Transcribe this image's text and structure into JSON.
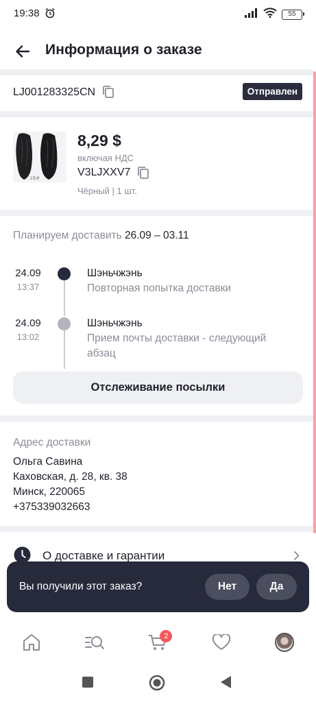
{
  "status_bar": {
    "time": "19:38",
    "battery": "55"
  },
  "header": {
    "title": "Информация о заказе"
  },
  "order": {
    "tracking_number": "LJ001283325CN",
    "status": "Отправлен"
  },
  "product": {
    "price": "8,29 $",
    "vat_note": "включая НДС",
    "sku": "V3LJXXV7",
    "variant": "Чёрный | 1 шт."
  },
  "delivery": {
    "plan_label": "Планируем доставить",
    "plan_dates": "26.09 – 03.11",
    "events": [
      {
        "date": "24.09",
        "time": "13:37",
        "city": "Шэньчжэнь",
        "description": "Повторная попытка доставки"
      },
      {
        "date": "24.09",
        "time": "13:02",
        "city": "Шэньчжэнь",
        "description": "Прием почты доставки - следующий абзац"
      }
    ],
    "track_button": "Отслеживание посылки"
  },
  "address": {
    "title": "Адрес доставки",
    "name": "Ольга Савина",
    "street": "Каховская, д. 28, кв. 38",
    "city": "Минск, 220065",
    "phone": "+375339032663"
  },
  "info_row": {
    "label": "О доставке и гарантии"
  },
  "toast": {
    "question": "Вы получили этот заказ?",
    "no_label": "Нет",
    "yes_label": "Да"
  },
  "bottom_nav": {
    "cart_count": "2",
    "items": [
      "home-icon",
      "catalog-search-icon",
      "cart-icon",
      "heart-icon",
      "profile-avatar"
    ]
  },
  "colors": {
    "badge_bg": "#2b2d3e",
    "scrollbar": "#f4a3a6",
    "cart_badge": "#f05a5e",
    "toast_bg": "#272a3b"
  }
}
